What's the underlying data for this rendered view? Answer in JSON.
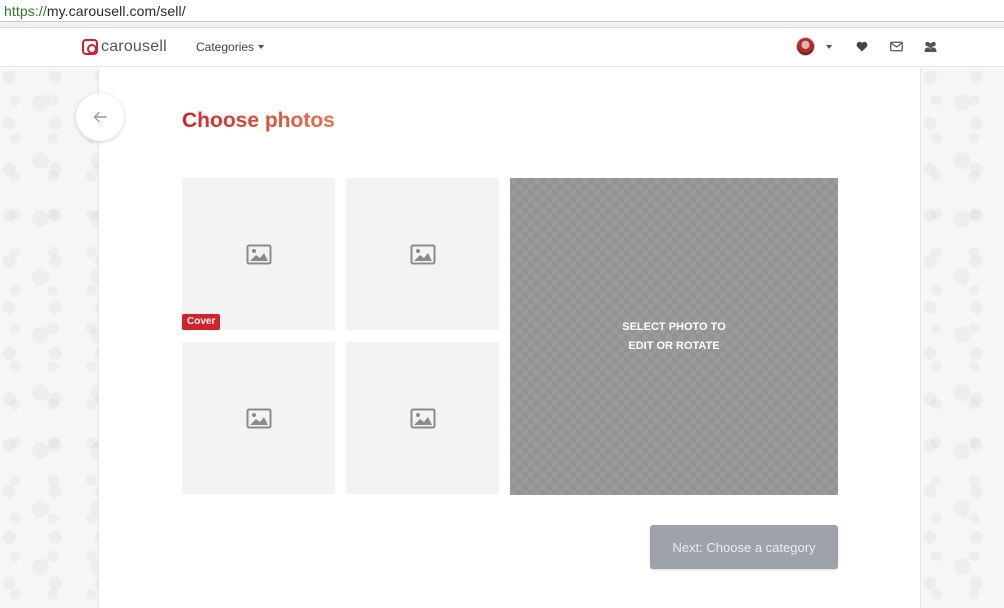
{
  "browser": {
    "url_scheme": "https://",
    "url_rest": "my.carousell.com/sell/"
  },
  "nav": {
    "logo_text": "carousell",
    "categories_label": "Categories",
    "icons": [
      "avatar",
      "heart-icon",
      "envelope-icon",
      "users-icon"
    ]
  },
  "page": {
    "title": "Choose photos",
    "cover_label": "Cover",
    "editor_line1": "SELECT PHOTO TO",
    "editor_line2": "EDIT OR ROTATE",
    "next_label": "Next: Choose a category"
  },
  "colors": {
    "brand_red": "#d2232a",
    "title_gradient_end": "#e8734a",
    "next_button_bg": "#9ea3ab",
    "slot_bg": "#f3f3f3"
  }
}
